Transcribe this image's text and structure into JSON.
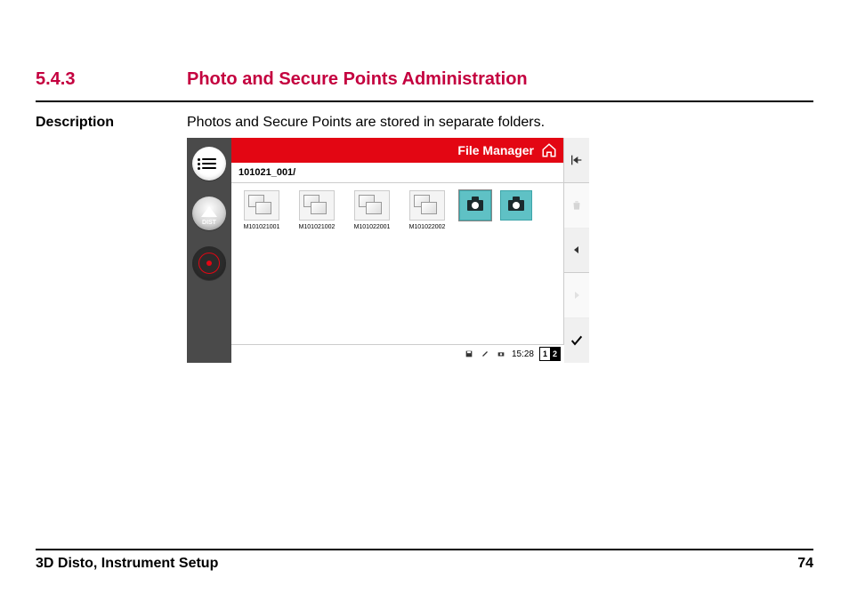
{
  "section": {
    "number": "5.4.3",
    "title": "Photo and Secure Points Administration"
  },
  "description": {
    "label": "Description",
    "text": "Photos and Secure Points are stored in separate folders."
  },
  "screenshot": {
    "header_title": "File Manager",
    "path": "101021_001/",
    "files": [
      {
        "label": "M101021001"
      },
      {
        "label": "M101021002"
      },
      {
        "label": "M101022001"
      },
      {
        "label": "M101022002"
      }
    ],
    "left_dist_label": "DIST",
    "status": {
      "time": "15:28",
      "page_a": "1",
      "page_b": "2"
    }
  },
  "footer": {
    "left": "3D Disto, Instrument Setup",
    "right": "74"
  }
}
